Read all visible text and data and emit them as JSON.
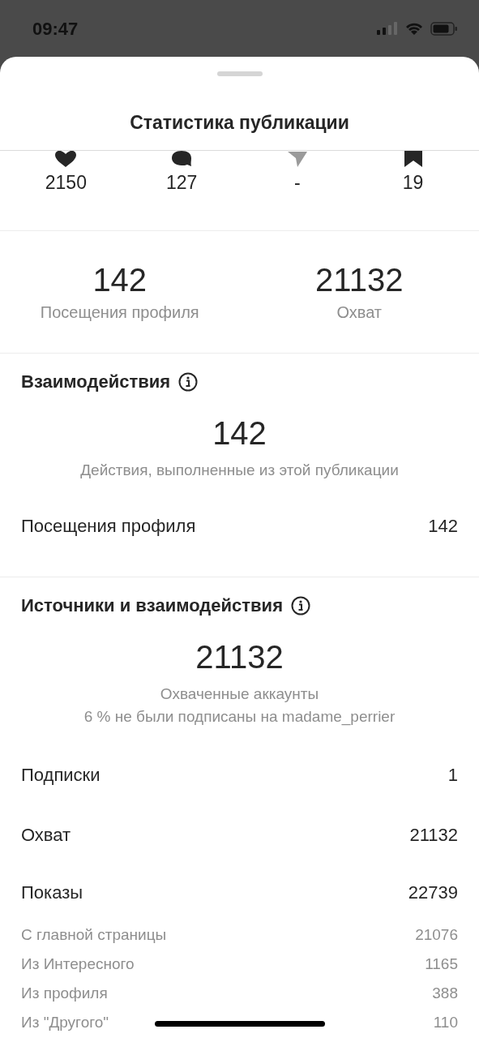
{
  "status_bar": {
    "time": "09:47"
  },
  "sheet": {
    "title": "Статистика публикации"
  },
  "post_counts": [
    {
      "kind": "heart",
      "value": "2150"
    },
    {
      "kind": "comment",
      "value": "127"
    },
    {
      "kind": "send",
      "value": "-"
    },
    {
      "kind": "bookmark",
      "value": "19"
    }
  ],
  "summary": [
    {
      "value": "142",
      "label": "Посещения профиля"
    },
    {
      "value": "21132",
      "label": "Охват"
    }
  ],
  "sections": [
    {
      "title": "Взаимодействия",
      "total": "142",
      "captions": [
        "Действия, выполненные из этой публикации"
      ],
      "rows": [
        {
          "kind": "main",
          "label": "Посещения профиля",
          "value": "142"
        }
      ]
    },
    {
      "title": "Источники и взаимодействия",
      "total": "21132",
      "captions": [
        "Охваченные аккаунты",
        "6 % не были подписаны на madame_perrier"
      ],
      "rows": [
        {
          "kind": "main",
          "label": "Подписки",
          "value": "1"
        },
        {
          "kind": "main",
          "label": "Охват",
          "value": "21132"
        },
        {
          "kind": "main",
          "label": "Показы",
          "value": "22739"
        },
        {
          "kind": "sub",
          "label": "С главной страницы",
          "value": "21076"
        },
        {
          "kind": "sub",
          "label": "Из Интересного",
          "value": "1165"
        },
        {
          "kind": "sub",
          "label": "Из профиля",
          "value": "388"
        },
        {
          "kind": "sub",
          "label": "Из \"Другого\"",
          "value": "110"
        }
      ]
    }
  ]
}
